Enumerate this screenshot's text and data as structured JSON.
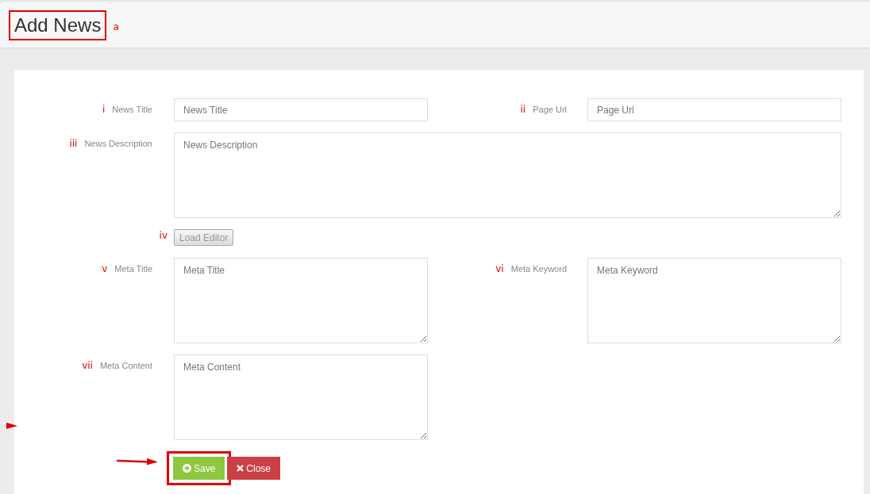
{
  "header": {
    "title": "Add News",
    "title_highlighted": true,
    "annotation": "a"
  },
  "rows": [
    {
      "kind": "pair",
      "fields": [
        {
          "marker": "i",
          "label": "News Title",
          "placeholder": "News Title",
          "kind": "input"
        },
        {
          "marker": "ii",
          "label": "Page Url",
          "placeholder": "Page Url",
          "kind": "input"
        }
      ]
    },
    {
      "kind": "wide",
      "fields": [
        {
          "marker": "iii",
          "label": "News Description",
          "placeholder": "News Description",
          "kind": "textarea"
        }
      ]
    },
    {
      "kind": "button",
      "marker": "iv",
      "button": "Load Editor"
    },
    {
      "kind": "pair",
      "fields": [
        {
          "marker": "v",
          "label": "Meta Title",
          "placeholder": "Meta Title",
          "kind": "textarea"
        },
        {
          "marker": "vi",
          "label": "Meta Keyword",
          "placeholder": "Meta Keyword",
          "kind": "textarea"
        }
      ]
    },
    {
      "kind": "pair",
      "fields": [
        {
          "marker": "vii",
          "label": "Meta Content",
          "placeholder": "Meta Content",
          "kind": "textarea"
        }
      ]
    }
  ],
  "actions": [
    {
      "label": "Save",
      "kind": "save",
      "highlighted": true
    },
    {
      "label": "Close",
      "kind": "close",
      "highlighted": false
    }
  ]
}
